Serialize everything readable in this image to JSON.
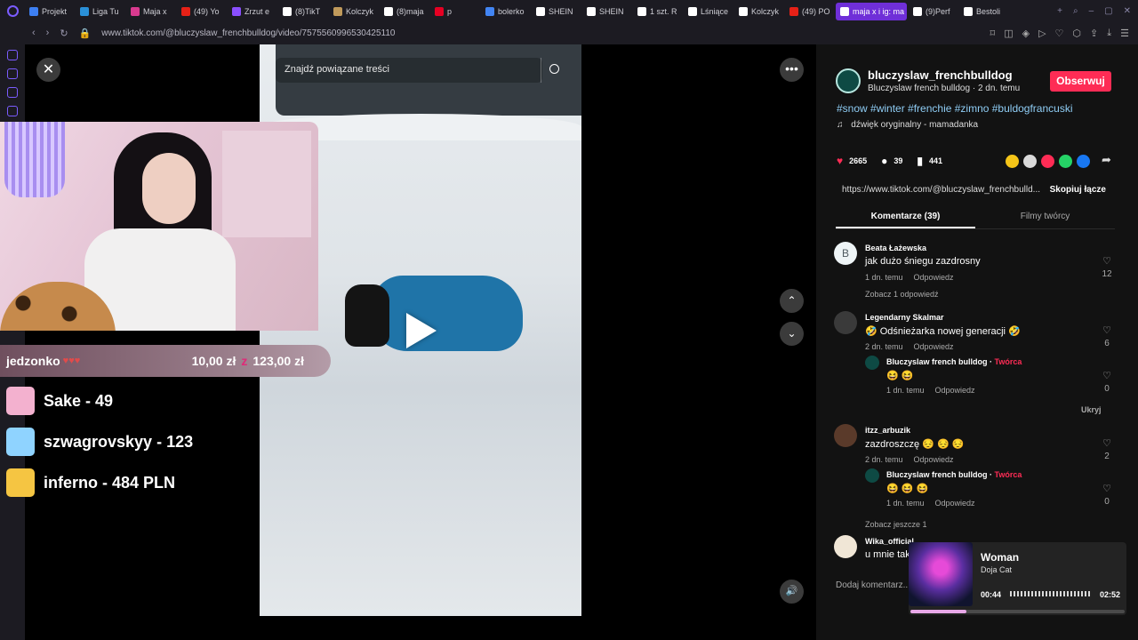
{
  "browser": {
    "tabs": [
      {
        "label": "Projekt",
        "color": "#3d7ff2"
      },
      {
        "label": "Liga Tu",
        "color": "#2a90d8"
      },
      {
        "label": "Maja x",
        "color": "#d93a8f"
      },
      {
        "label": "(49) Yo",
        "color": "#e62117"
      },
      {
        "label": "Zrzut e",
        "color": "#8a4fff"
      },
      {
        "label": "(8)TikT",
        "color": "#ffffff"
      },
      {
        "label": "Kolczyk",
        "color": "#c09a5b"
      },
      {
        "label": "(8)maja",
        "color": "#ffffff"
      },
      {
        "label": "p",
        "color": "#e60023"
      },
      {
        "label": "bolerko",
        "color": "#4285f4"
      },
      {
        "label": "SHEIN",
        "color": "#ffffff"
      },
      {
        "label": "SHEIN",
        "color": "#ffffff"
      },
      {
        "label": "1 szt. R",
        "color": "#ffffff"
      },
      {
        "label": "Lśniące",
        "color": "#ffffff"
      },
      {
        "label": "Kolczyk",
        "color": "#ffffff"
      },
      {
        "label": "(49) PO",
        "color": "#e62117"
      },
      {
        "label": "maja x i ig: ma",
        "color": "#ffffff",
        "active": true
      },
      {
        "label": "(9)Perf",
        "color": "#ffffff"
      },
      {
        "label": "Bestoli",
        "color": "#ffffff"
      }
    ],
    "url": "www.tiktok.com/@bluczyslaw_frenchbulldog/video/7575560996530425110"
  },
  "video": {
    "search_placeholder": "Znajdź powiązane treści"
  },
  "overlay": {
    "donation": {
      "name": "jedzonko",
      "amount": "10,00 zł",
      "sep": "z",
      "total": "123,00 zł"
    },
    "leaderboard": [
      {
        "text": "Sake - 49",
        "icon": "gift-icon",
        "color": "#f3b1cf"
      },
      {
        "text": "szwagrovskyy - 123",
        "icon": "diamond-icon",
        "color": "#8fd3ff"
      },
      {
        "text": "inferno - 484 PLN",
        "icon": "coins-icon",
        "color": "#f5c542"
      }
    ]
  },
  "post": {
    "username": "bluczyslaw_frenchbulldog",
    "subtitle": "Bluczyslaw french bulldog · 2 dn. temu",
    "follow_label": "Obserwuj",
    "hashtags": "#snow #winter #frenchie #zimno #buldogfrancuski",
    "sound": "dźwięk oryginalny - mamadanka",
    "likes": "2665",
    "comments": "39",
    "saves": "441",
    "link": "https://www.tiktok.com/@bluczyslaw_frenchbulld...",
    "copy_label": "Skopiuj łącze",
    "tab_comments": "Komentarze (39)",
    "tab_creator": "Filmy twórcy",
    "add_comment": "Dodaj komentarz..."
  },
  "comments": [
    {
      "name": "Beata Łażewska",
      "text": "jak dużo śniegu zazdrosny",
      "time": "1 dn. temu",
      "reply": "Odpowiedz",
      "likes": "12",
      "more": "Zobacz 1 odpowiedź"
    },
    {
      "name": "Legendarny Skalmar",
      "text": "🤣 Odśnieżarka nowej generacji 🤣",
      "time": "2 dn. temu",
      "reply": "Odpowiedz",
      "likes": "6",
      "sub": {
        "name": "Bluczyslaw french bulldog",
        "creator": "Twórca",
        "text": "😆 😆",
        "time": "1 dn. temu",
        "reply": "Odpowiedz",
        "likes": "0"
      },
      "hide": "Ukryj"
    },
    {
      "name": "itzz_arbuzik",
      "text": "zazdroszczę 😔 😔 😔",
      "time": "2 dn. temu",
      "reply": "Odpowiedz",
      "likes": "2",
      "sub": {
        "name": "Bluczyslaw french bulldog",
        "creator": "Twórca",
        "text": "😆 😆 😆",
        "time": "1 dn. temu",
        "reply": "Odpowiedz",
        "likes": "0"
      },
      "more": "Zobacz jeszcze 1"
    },
    {
      "name": "Wika_official",
      "text": "u mnie tak"
    }
  ],
  "player": {
    "title": "Woman",
    "artist": "Doja Cat",
    "current": "00:44",
    "total": "02:52",
    "progress": 0.26
  }
}
